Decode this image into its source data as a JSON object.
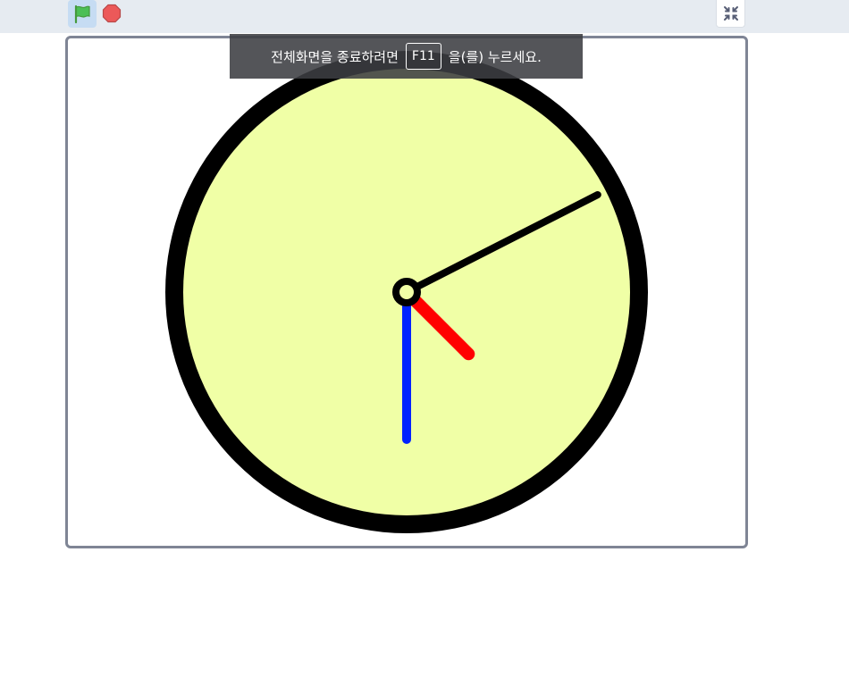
{
  "toolbar": {
    "green_flag_icon": "green-flag-icon",
    "stop_icon": "stop-sign-icon",
    "exit_fullscreen_icon": "exit-fullscreen-icon"
  },
  "fullscreen_banner": {
    "before_key": "전체화면을 종료하려면",
    "key": "F11",
    "after_key": "을(를) 누르세요."
  },
  "clock": {
    "face_color": "#f0ffa6",
    "rim_color": "#000000",
    "hour_hand_color": "#ff0000",
    "minute_hand_color": "#0022ff",
    "second_hand_color": "#000000",
    "hour": 4.5,
    "minute": 30,
    "second": 10.5
  }
}
